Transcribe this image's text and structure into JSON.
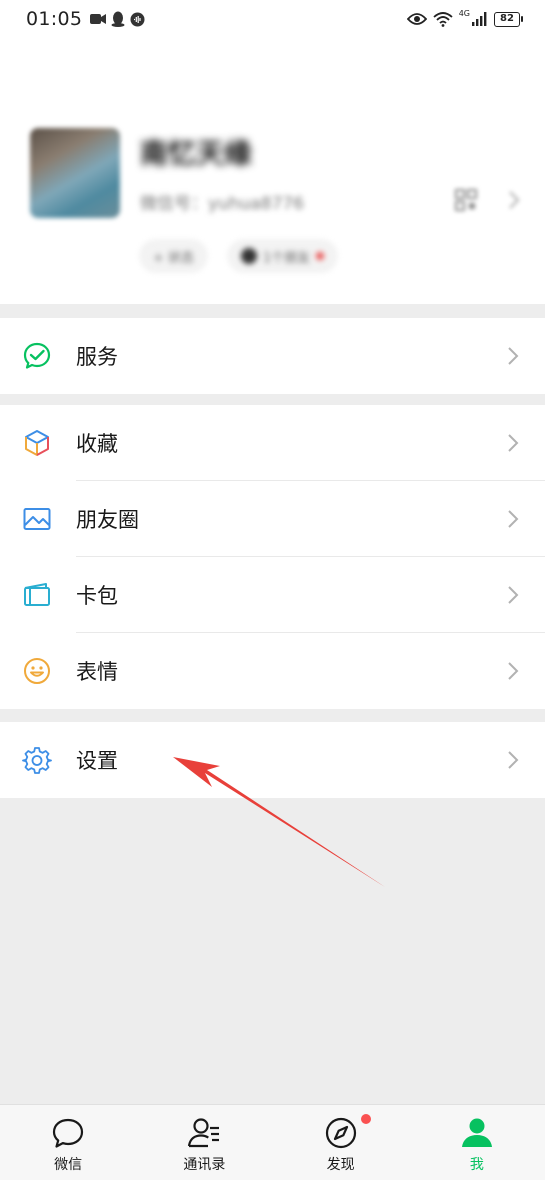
{
  "status_bar": {
    "time": "01:05",
    "network": "4G",
    "battery": "82"
  },
  "profile": {
    "nickname": "南忆天缘",
    "wechat_id": "微信号：yuhua8776",
    "status_chip": "+ 状态",
    "friends_chip": "1个朋友"
  },
  "menu": {
    "services": {
      "label": "服务",
      "icon": "wechat-pay-icon"
    },
    "favorites": {
      "label": "收藏",
      "icon": "cube-icon"
    },
    "moments": {
      "label": "朋友圈",
      "icon": "photo-icon"
    },
    "cards": {
      "label": "卡包",
      "icon": "card-icon"
    },
    "stickers": {
      "label": "表情",
      "icon": "smile-icon"
    },
    "settings": {
      "label": "设置",
      "icon": "gear-icon"
    }
  },
  "tabbar": {
    "tabs": [
      {
        "label": "微信",
        "icon": "chat-bubble-icon"
      },
      {
        "label": "通讯录",
        "icon": "contacts-icon"
      },
      {
        "label": "发现",
        "icon": "compass-icon",
        "has_badge": true
      },
      {
        "label": "我",
        "icon": "person-icon",
        "active": true
      }
    ]
  },
  "colors": {
    "accent_green": "#07c160",
    "annotation_red": "#e8403a",
    "background": "#ededed"
  }
}
